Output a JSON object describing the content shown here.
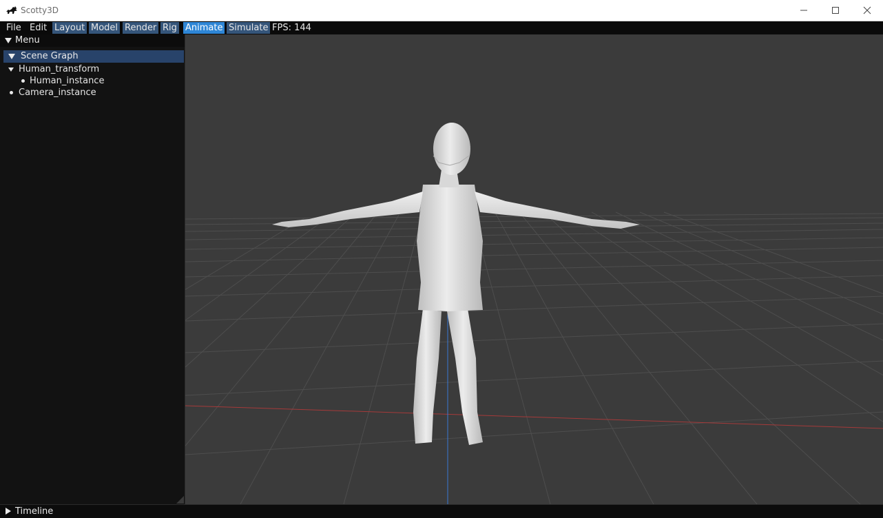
{
  "window": {
    "title": "Scotty3D",
    "logo_icon": "scotty-dog-icon"
  },
  "menubar": {
    "items": [
      {
        "label": "File"
      },
      {
        "label": "Edit"
      },
      {
        "label": "Layout"
      },
      {
        "label": "Model"
      },
      {
        "label": "Render"
      },
      {
        "label": "Rig"
      },
      {
        "label": "Animate"
      },
      {
        "label": "Simulate"
      }
    ],
    "active_mode": "Animate",
    "fps_text": "FPS: 144"
  },
  "panel": {
    "header": "Menu",
    "section": "Scene Graph",
    "tree": {
      "transform": "Human_transform",
      "instance": "Human_instance",
      "camera": "Camera_instance"
    }
  },
  "timeline": {
    "label": "Timeline"
  },
  "colors": {
    "active_tab": "#2e86d6",
    "mode_tab": "#35557a",
    "section_header": "#28436a",
    "viewport_bg": "#3b3b3b",
    "x_axis": "#b23a3a",
    "z_axis": "#3a78d6"
  }
}
